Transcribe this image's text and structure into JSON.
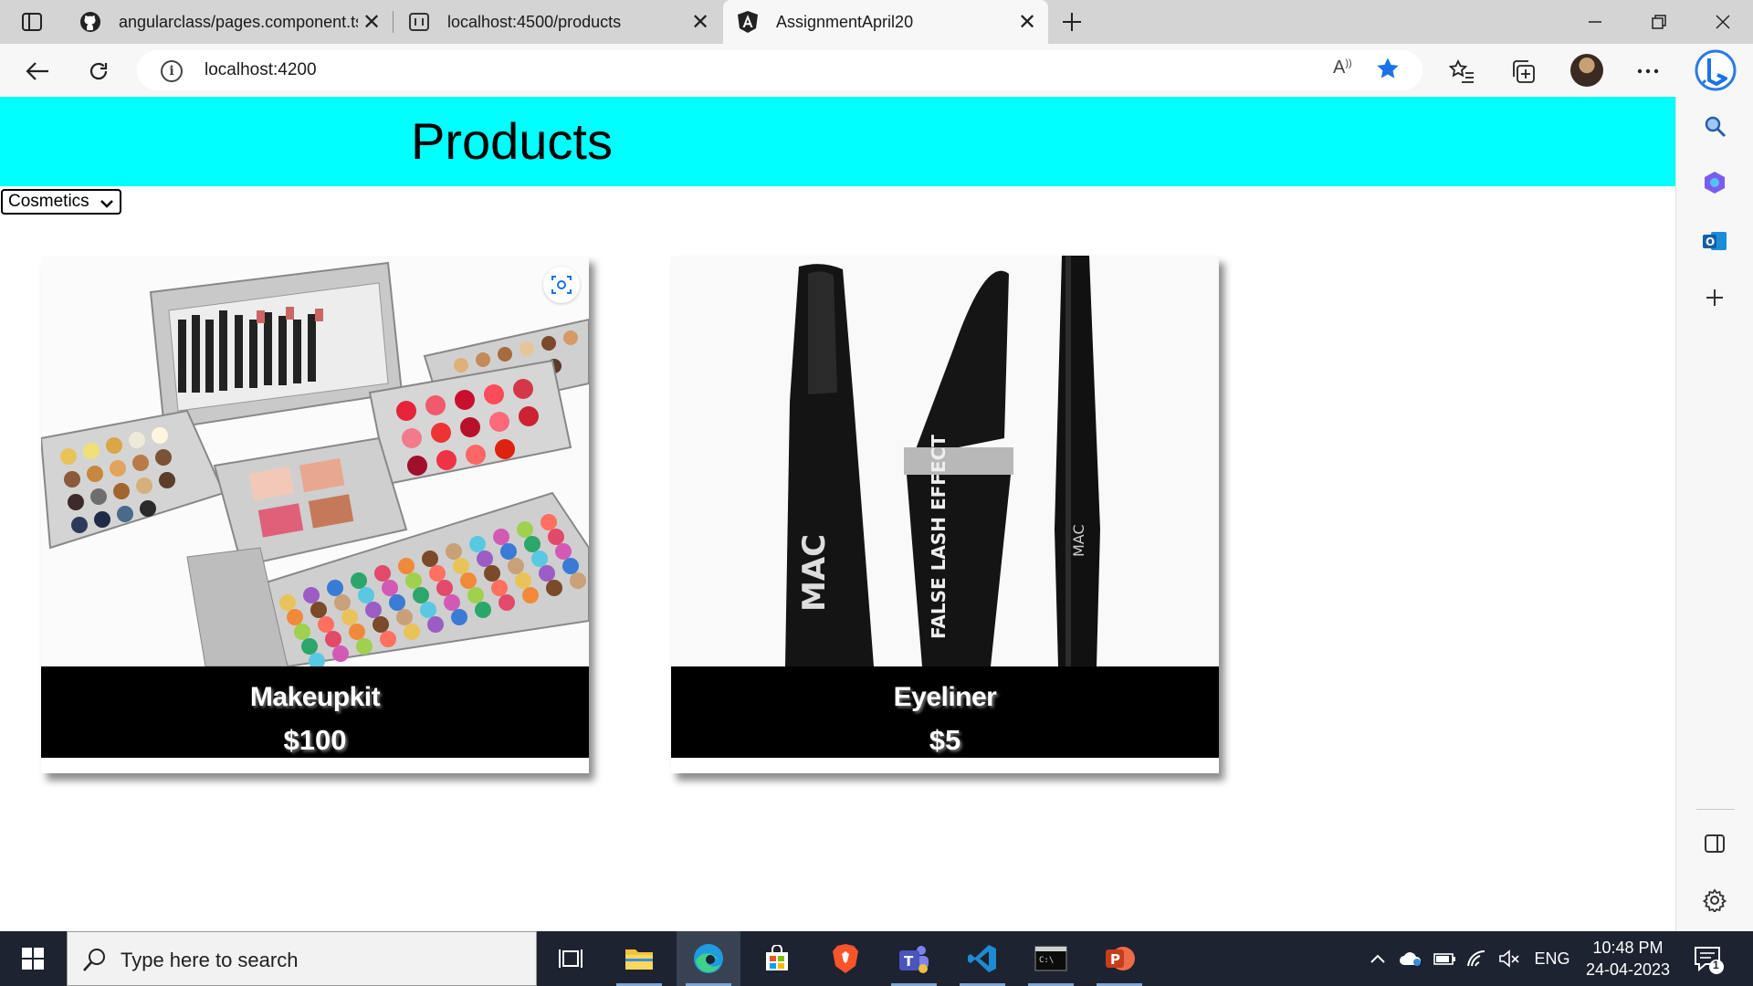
{
  "browser": {
    "tabs": [
      {
        "title": "angularclass/pages.component.ts",
        "icon": "github-icon",
        "active": false
      },
      {
        "title": "localhost:4500/products",
        "icon": "page-icon",
        "active": false
      },
      {
        "title": "AssignmentApril20",
        "icon": "angular-icon",
        "active": true
      }
    ],
    "address": "localhost:4200"
  },
  "page": {
    "title": "Products",
    "category_select": {
      "selected": "Cosmetics"
    },
    "products": [
      {
        "name": "Makeupkit",
        "price": "$100",
        "image": "makeup-kit-image"
      },
      {
        "name": "Eyeliner",
        "price": "$5",
        "image": "eyeliner-image"
      }
    ]
  },
  "taskbar": {
    "search_placeholder": "Type here to search",
    "language": "ENG",
    "time": "10:48 PM",
    "date": "24-04-2023",
    "notification_count": "1"
  },
  "colors": {
    "header_bg": "#00ffff",
    "caption_bg": "#000000",
    "edge_accent": "#1a73e8"
  }
}
